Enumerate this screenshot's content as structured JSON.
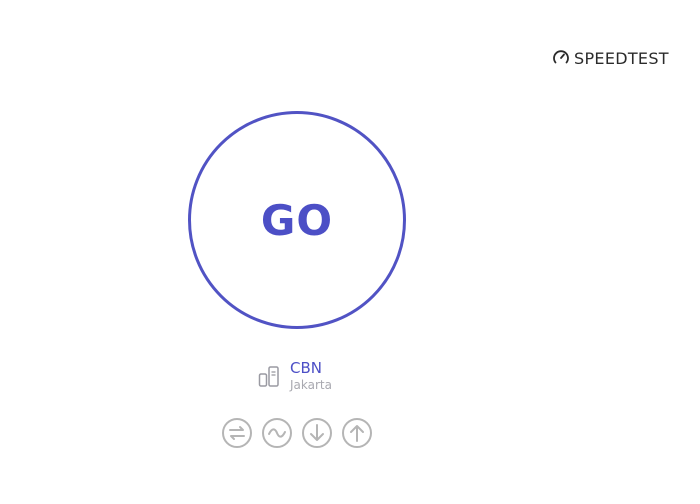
{
  "brand": {
    "name": "SPEEDTEST",
    "icon": "speedometer-icon"
  },
  "go_button": {
    "label": "GO",
    "color": "#4c4fc6"
  },
  "server": {
    "icon": "server-icon",
    "isp": "CBN",
    "location": "Jakarta"
  },
  "mode_icons": [
    {
      "name": "multi-connection-icon"
    },
    {
      "name": "single-connection-icon"
    },
    {
      "name": "download-icon"
    },
    {
      "name": "upload-icon"
    }
  ],
  "colors": {
    "accent": "#4c4fc6",
    "muted": "#a9a9b0",
    "icon_gray": "#b5b5b5"
  }
}
